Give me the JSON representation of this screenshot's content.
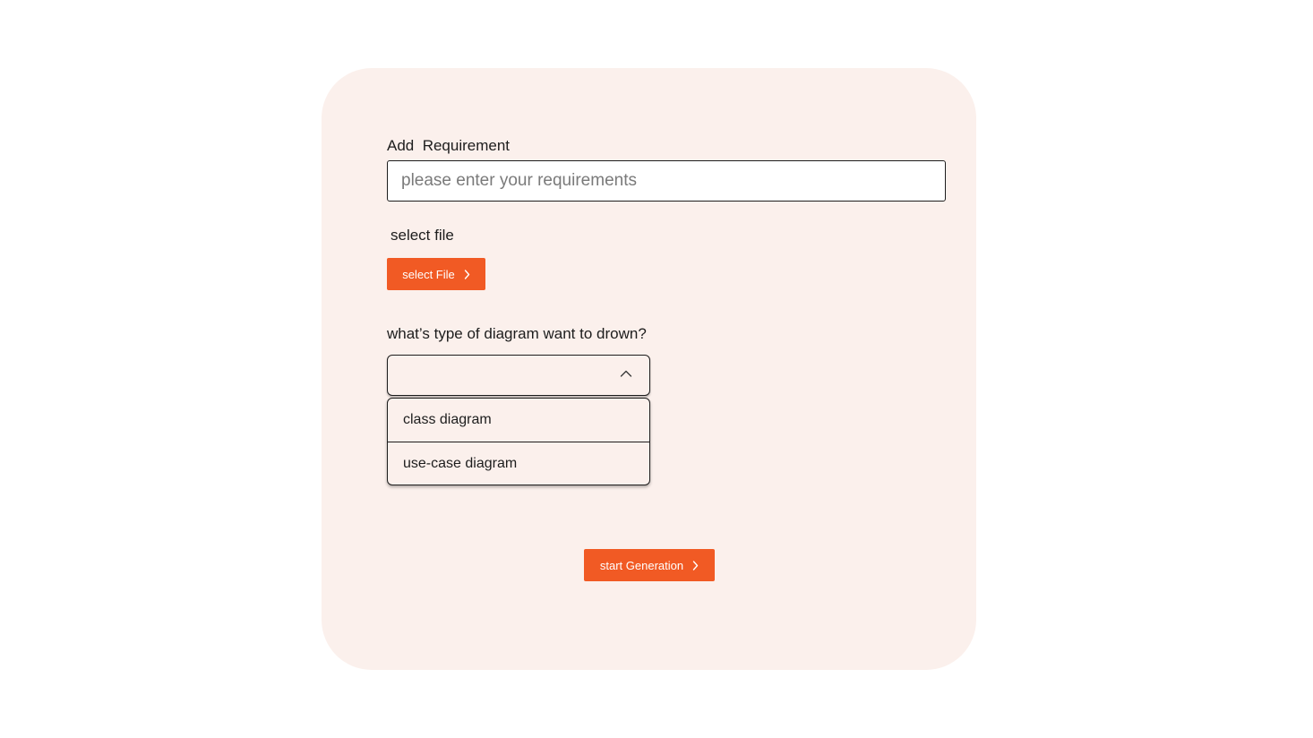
{
  "form": {
    "requirement_label": "Add  Requirement",
    "requirement_placeholder": "please enter your requirements",
    "requirement_value": "",
    "file_label": "select file",
    "file_button_label": "select File",
    "diagram_type_label": "what’s type of diagram want to drown?",
    "diagram_type_value": "",
    "diagram_options": [
      "class diagram",
      "use-case diagram"
    ],
    "start_button_label": "start Generation"
  },
  "icons": {
    "button_chevron": "chevron-right-icon",
    "select_chevron": "chevron-up-icon"
  },
  "colors": {
    "accent": "#f15a24",
    "card_background": "#fbf0ec",
    "text": "#1d1d1d"
  }
}
